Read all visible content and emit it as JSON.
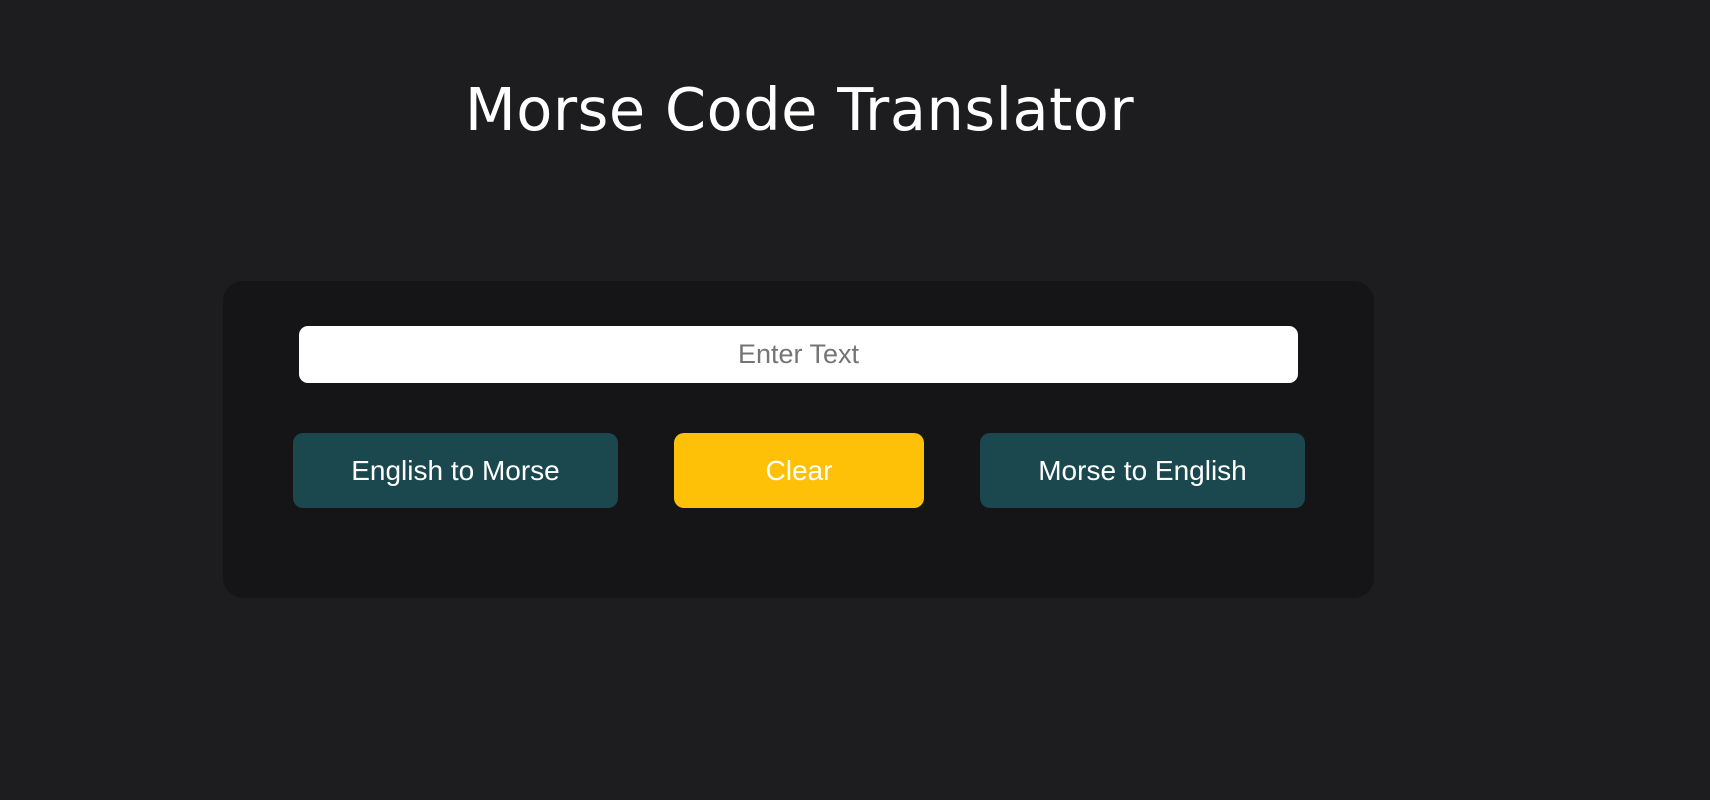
{
  "app": {
    "title": "Morse Code Translator"
  },
  "translator": {
    "input": {
      "placeholder": "Enter Text",
      "value": ""
    },
    "buttons": {
      "english_to_morse": "English to Morse",
      "clear": "Clear",
      "morse_to_english": "Morse to English"
    }
  },
  "colors": {
    "page_background": "#1d1d1f",
    "panel_background": "#151517",
    "primary_button": "#1b474e",
    "clear_button": "#ffc107",
    "text": "#ffffff"
  }
}
